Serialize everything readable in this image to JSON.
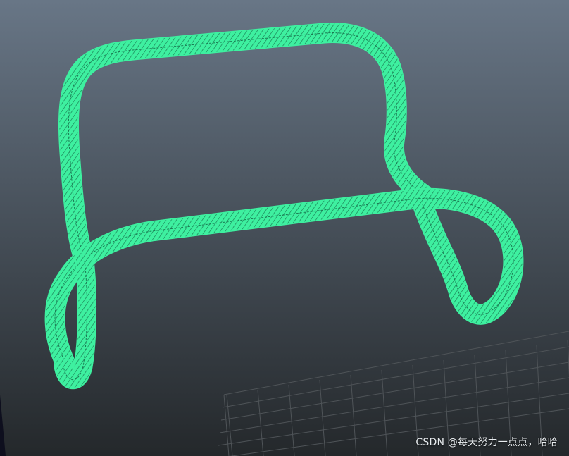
{
  "viewport": {
    "background_top": "#687686",
    "background_bottom": "#24282b",
    "grid_color": "#4f5458",
    "wireframe_color": "#3ef0a0",
    "wireframe_line_color": "#1a7a52"
  },
  "object": {
    "type": "tube-wireframe",
    "icon": "bent-tube-wireframe"
  },
  "watermark": {
    "text": "CSDN @每天努力一点点，哈哈"
  }
}
